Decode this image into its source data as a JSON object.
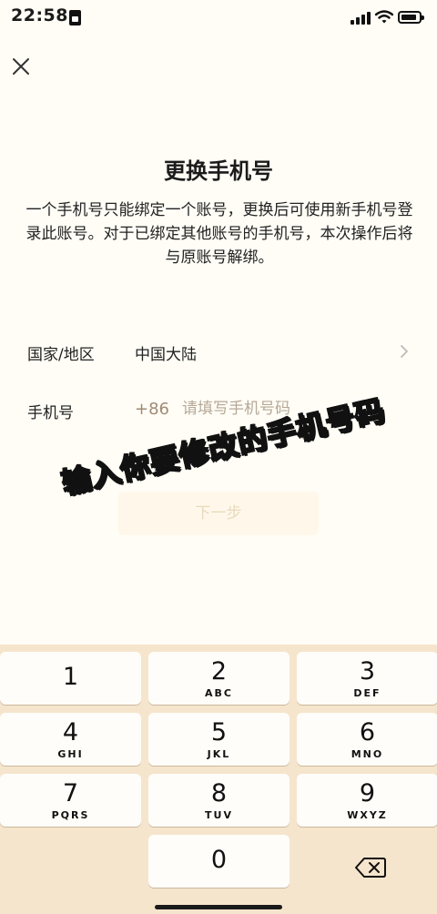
{
  "status_bar": {
    "time": "22:58"
  },
  "header": {
    "title": "更换手机号"
  },
  "description": "一个手机号只能绑定一个账号，更换后可使用新手机号登录此账号。对于已绑定其他账号的手机号，本次操作后将与原账号解绑。",
  "form": {
    "region_label": "国家/地区",
    "region_value": "中国大陆",
    "phone_label": "手机号",
    "country_code": "+86",
    "phone_placeholder": "请填写手机号码",
    "phone_value": ""
  },
  "overlay_caption": "输入你要修改的手机号码",
  "next_button": "下一步",
  "keypad": {
    "keys": [
      {
        "digit": "1",
        "letters": ""
      },
      {
        "digit": "2",
        "letters": "ABC"
      },
      {
        "digit": "3",
        "letters": "DEF"
      },
      {
        "digit": "4",
        "letters": "GHI"
      },
      {
        "digit": "5",
        "letters": "JKL"
      },
      {
        "digit": "6",
        "letters": "MNO"
      },
      {
        "digit": "7",
        "letters": "PQRS"
      },
      {
        "digit": "8",
        "letters": "TUV"
      },
      {
        "digit": "9",
        "letters": "WXYZ"
      },
      {
        "digit": "0",
        "letters": ""
      }
    ]
  },
  "colors": {
    "background": "#fffdf6",
    "keyboard": "#f6e5cd",
    "placeholder": "#b6a897",
    "disabled_button_text": "#e8d9bc"
  }
}
